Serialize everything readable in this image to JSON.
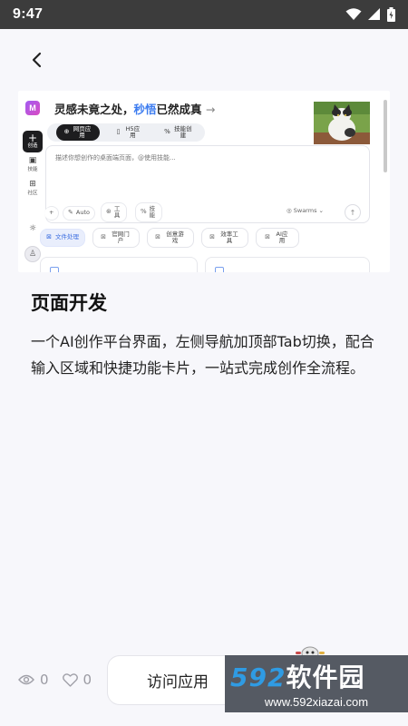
{
  "status_bar": {
    "time": "9:47"
  },
  "preview": {
    "logo_letter": "M",
    "headline_pre": "灵感未竟之处，",
    "headline_highlight": "秒悟",
    "headline_post": "已然成真",
    "headline_arrow": "→",
    "tabs": [
      {
        "label": "网页应用",
        "icon": "globe-icon"
      },
      {
        "label": "H5应用",
        "icon": "phone-icon"
      },
      {
        "label": "技能创建",
        "icon": "skill-icon"
      }
    ],
    "sidebar": [
      {
        "label": "创造",
        "icon": "plus-icon"
      },
      {
        "label": "技能",
        "icon": "calendar-icon"
      },
      {
        "label": "社区",
        "icon": "grid-icon"
      }
    ],
    "input_placeholder": "描述你想创作的桌面端页面，@使用技能...",
    "tools": [
      {
        "label": "Auto",
        "icon": "magic-icon"
      },
      {
        "label": "工具",
        "icon": "tool-icon"
      },
      {
        "label": "技能",
        "icon": "link-icon"
      }
    ],
    "swarms_label": "Swarms",
    "chips": [
      {
        "label": "文件处理",
        "icon": "file-icon"
      },
      {
        "label": "官网门户",
        "icon": "file-icon"
      },
      {
        "label": "创意游戏",
        "icon": "file-icon"
      },
      {
        "label": "效率工具",
        "icon": "file-icon"
      },
      {
        "label": "AI应用",
        "icon": "file-icon"
      }
    ]
  },
  "title": "页面开发",
  "description": "一个AI创作平台界面，左侧导航加顶部Tab切换，配合输入区域和快捷功能卡片，一站式完成创作全流程。",
  "stats": {
    "views": "0",
    "likes": "0"
  },
  "visit_button": "访问应用",
  "watermark": {
    "number": "592",
    "name": "软件园",
    "url": "www.592xiazai.com"
  }
}
